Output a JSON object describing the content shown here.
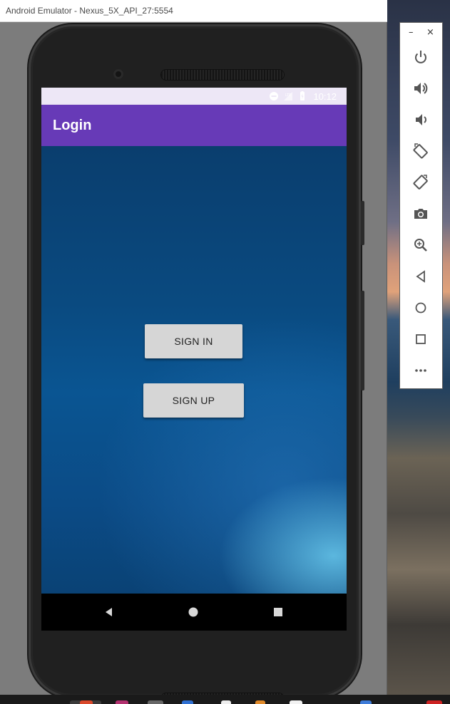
{
  "window": {
    "title": "Android Emulator - Nexus_5X_API_27:5554"
  },
  "status_bar": {
    "time": "10:12",
    "icons": [
      "do-not-disturb-icon",
      "signal-icon",
      "battery-icon"
    ]
  },
  "app_bar": {
    "title": "Login"
  },
  "buttons": {
    "sign_in": "SIGN IN",
    "sign_up": "SIGN UP"
  },
  "nav_bar": {
    "items": [
      "back-icon",
      "home-icon",
      "recents-icon"
    ]
  },
  "emulator_toolbar": {
    "minimize": "–",
    "close": "×",
    "tools": [
      "power-icon",
      "volume-up-icon",
      "volume-down-icon",
      "rotate-left-icon",
      "rotate-right-icon",
      "camera-icon",
      "zoom-icon",
      "back-icon",
      "home-icon",
      "overview-icon",
      "more-icon"
    ]
  },
  "colors": {
    "app_bar": "#673ab7",
    "status_bar": "#ede7f6",
    "button": "#d6d6d6"
  }
}
